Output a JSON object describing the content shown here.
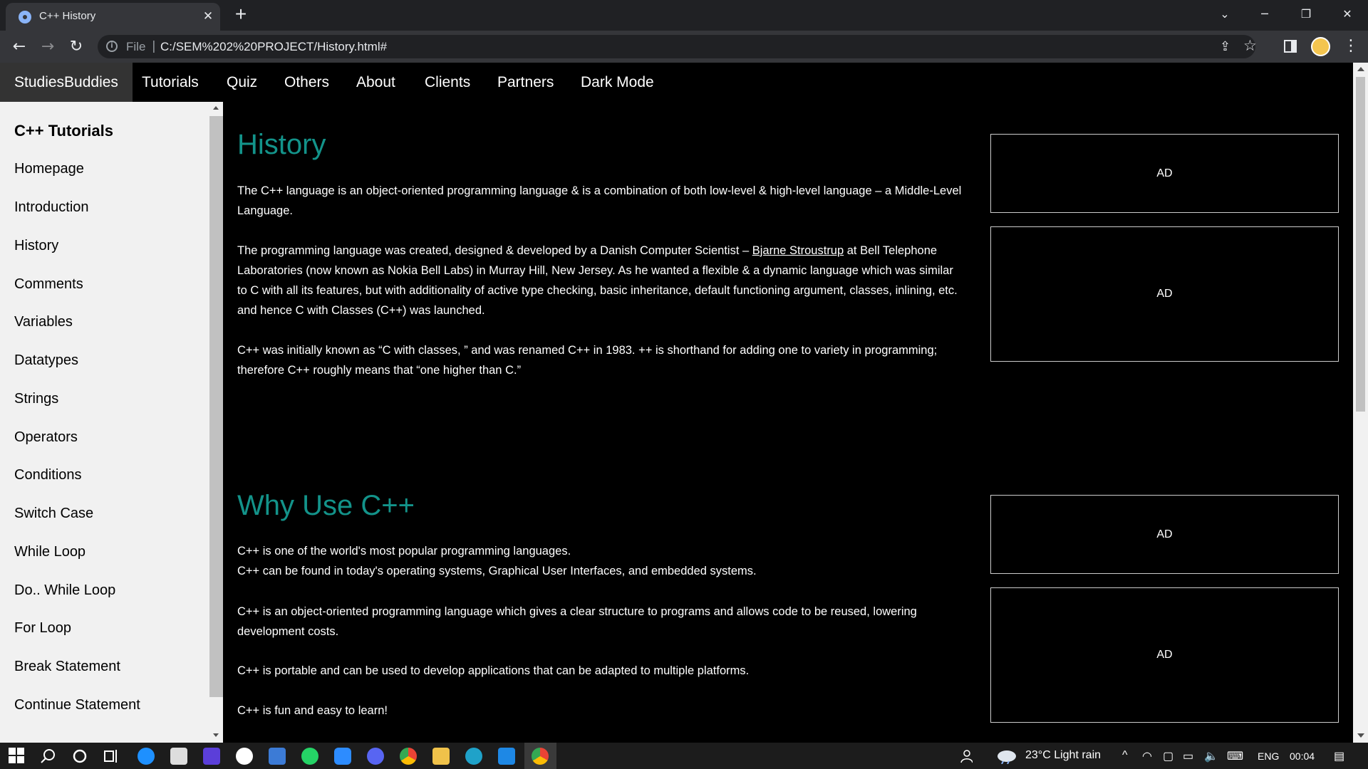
{
  "browser": {
    "tab_title": "C++ History",
    "file_label": "File",
    "url": "C:/SEM%202%20PROJECT/History.html#"
  },
  "nav": {
    "brand": "StudiesBuddies",
    "items": [
      "Tutorials",
      "Quiz",
      "Others",
      "About",
      "Clients",
      "Partners",
      "Dark Mode"
    ]
  },
  "sidebar": {
    "title": "C++ Tutorials",
    "links": [
      "Homepage",
      "Introduction",
      "History",
      "Comments",
      "Variables",
      "Datatypes",
      "Strings",
      "Operators",
      "Conditions",
      "Switch Case",
      "While Loop",
      "Do.. While Loop",
      "For Loop",
      "Break Statement",
      "Continue Statement"
    ]
  },
  "content": {
    "history_title": "History",
    "p1": "The C++ language is an object-oriented programming language & is a combination of both low-level & high-level language – a Middle-Level Language.",
    "p2_before": "The programming language was created, designed & developed by a Danish Computer Scientist – ",
    "p2_link": "Bjarne Stroustrup",
    "p2_after": " at Bell Telephone Laboratories (now known as Nokia Bell Labs) in Murray Hill, New Jersey. As he wanted a flexible & a dynamic language which was similar to C with all its features, but with additionality of active type checking, basic inheritance, default functioning argument, classes, inlining, etc. and hence C with Classes (C++) was launched.",
    "p3": "C++ was initially known as “C with classes, ” and was renamed C++ in 1983. ++ is shorthand for adding one to variety in programming; therefore C++ roughly means that “one higher than C.”",
    "why_title": "Why Use C++",
    "w1": "C++ is one of the world's most popular programming languages.",
    "w2": "C++ can be found in today's operating systems, Graphical User Interfaces, and embedded systems.",
    "w3": "C++ is an object-oriented programming language which gives a clear structure to programs and allows code to be reused, lowering development costs.",
    "w4": "C++ is portable and can be used to develop applications that can be adapted to multiple platforms.",
    "w5": "C++ is fun and easy to learn!"
  },
  "ads": [
    "AD",
    "AD",
    "AD",
    "AD"
  ],
  "taskbar": {
    "weather": "23°C  Light rain",
    "language": "ENG",
    "time": "00:04"
  },
  "colors": {
    "heading": "#13938a",
    "brand_bg": "#333333",
    "sidebar_bg": "#f1f1f1"
  }
}
